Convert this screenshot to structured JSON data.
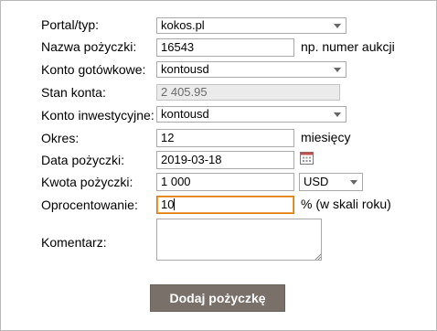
{
  "form": {
    "portal": {
      "label": "Portal/typ:",
      "value": "kokos.pl"
    },
    "loan_name": {
      "label": "Nazwa pożyczki:",
      "value": "16543",
      "hint": "np. numer aukcji"
    },
    "cash_account": {
      "label": "Konto gotówkowe:",
      "value": "kontousd"
    },
    "balance": {
      "label": "Stan konta:",
      "value": "2 405.95"
    },
    "investment_account": {
      "label": "Konto inwestycyjne:",
      "value": "kontousd"
    },
    "period": {
      "label": "Okres:",
      "value": "12",
      "unit": "miesięcy"
    },
    "loan_date": {
      "label": "Data pożyczki:",
      "value": "2019-03-18"
    },
    "amount": {
      "label": "Kwota pożyczki:",
      "value": "1 000",
      "currency": "USD"
    },
    "interest": {
      "label": "Oprocentowanie:",
      "value": "10",
      "unit": "% (w skali roku)"
    },
    "comment": {
      "label": "Komentarz:",
      "value": ""
    },
    "submit_label": "Dodaj pożyczkę"
  },
  "icons": {
    "calendar": "calendar-icon",
    "dropdown": "chevron-down-icon"
  },
  "colors": {
    "button": "#7a706a",
    "focus": "#e07800",
    "disabled_bg": "#ebebeb"
  }
}
